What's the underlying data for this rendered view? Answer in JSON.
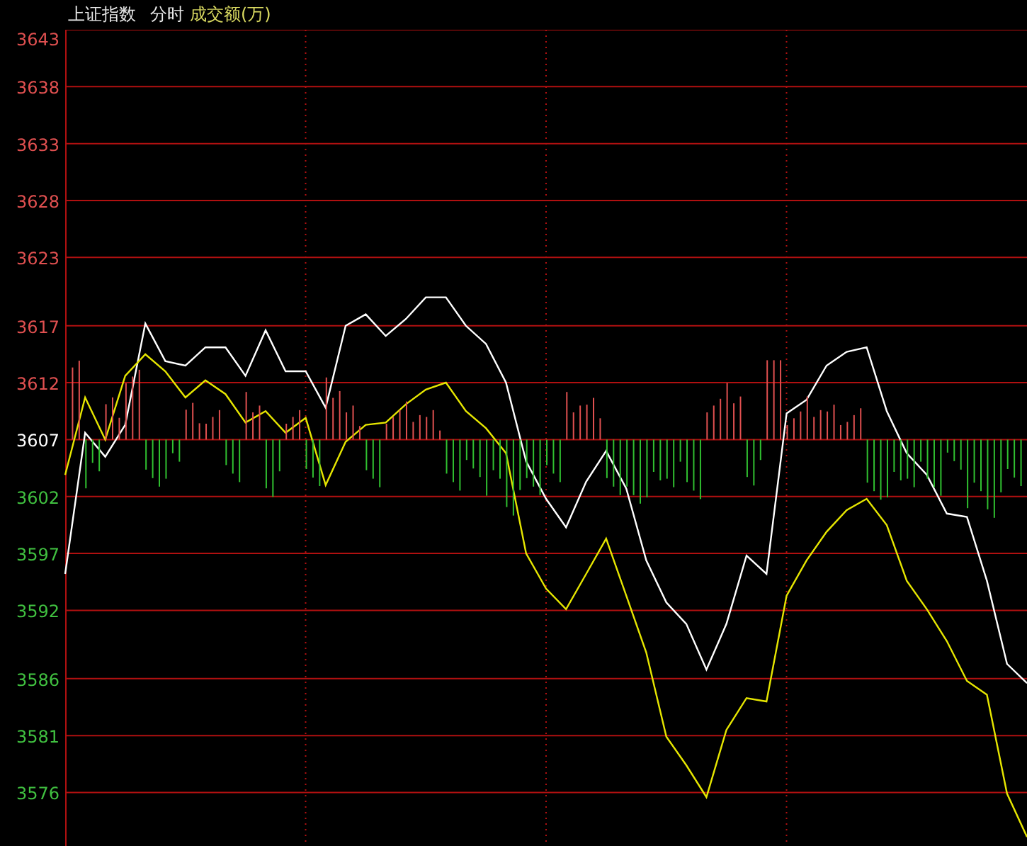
{
  "header": {
    "title": "上证指数",
    "mode": "分时",
    "indicator": "成交额(万)"
  },
  "chart_data": {
    "type": "line",
    "grid": true,
    "ylim": [
      3571.3,
      3643
    ],
    "yticks": [
      3643,
      3638,
      3633,
      3628,
      3623,
      3617,
      3612,
      3607,
      3602,
      3597,
      3592,
      3586,
      3581,
      3576
    ],
    "series": [
      {
        "color": "#ffffff",
        "values": [
          3595.2,
          3607.6,
          3605.5,
          3608.3,
          3617.2,
          3613.9,
          3613.5,
          3615.1,
          3615.1,
          3612.6,
          3616.6,
          3613.0,
          3613.0,
          3609.8,
          3617.0,
          3618.0,
          3616.1,
          3617.6,
          3619.5,
          3619.5,
          3617.0,
          3615.4,
          3612.0,
          3605.1,
          3601.8,
          3599.3,
          3603.3,
          3606.0,
          3602.7,
          3596.4,
          3592.7,
          3590.8,
          3586.8,
          3590.8,
          3596.8,
          3595.2,
          3609.3,
          3610.5,
          3613.5,
          3614.7,
          3615.1,
          3609.5,
          3605.8,
          3603.9,
          3600.5,
          3600.2,
          3594.6,
          3587.3,
          3585.6
        ]
      },
      {
        "color": "#e6e600",
        "values": [
          3603.9,
          3610.7,
          3607.0,
          3612.6,
          3614.5,
          3613.0,
          3610.7,
          3612.2,
          3611.0,
          3608.5,
          3609.5,
          3607.6,
          3608.9,
          3603.0,
          3606.8,
          3608.3,
          3608.5,
          3610.1,
          3611.4,
          3612.0,
          3609.5,
          3608.0,
          3605.8,
          3597.0,
          3593.9,
          3592.1,
          3595.2,
          3598.3,
          3593.3,
          3588.3,
          3580.9,
          3578.4,
          3575.6,
          3581.5,
          3584.3,
          3584.0,
          3593.3,
          3596.4,
          3598.9,
          3600.8,
          3601.8,
          3599.5,
          3594.6,
          3592.1,
          3589.3,
          3585.8,
          3584.6,
          3575.9,
          3572.1
        ]
      }
    ]
  }
}
